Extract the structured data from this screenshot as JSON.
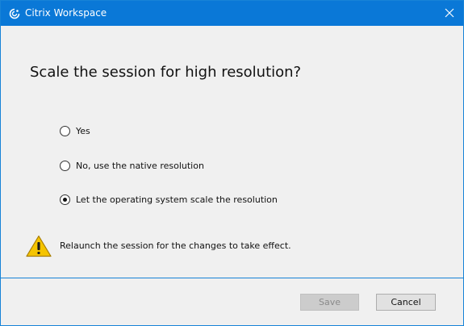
{
  "window": {
    "title": "Citrix Workspace",
    "title_icon": "citrix-workspace-icon",
    "close_icon": "close-icon",
    "titlebar_color": "#0a78d7"
  },
  "dialog": {
    "heading": "Scale the session for high resolution?",
    "options": [
      {
        "label": "Yes",
        "selected": false
      },
      {
        "label": "No, use the native resolution",
        "selected": false
      },
      {
        "label": "Let the operating system scale the resolution",
        "selected": true
      }
    ],
    "warning_icon": "warning-icon",
    "warning_text": "Relaunch the session for the changes to take effect."
  },
  "buttons": {
    "save_label": "Save",
    "save_enabled": false,
    "cancel_label": "Cancel"
  }
}
